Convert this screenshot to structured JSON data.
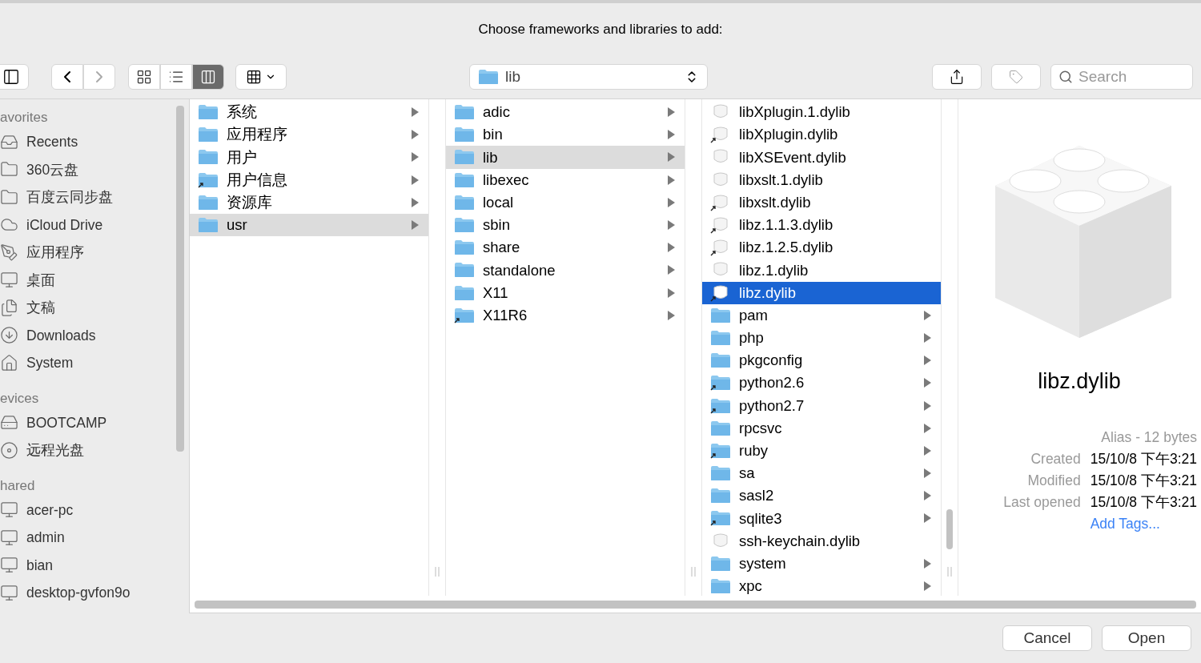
{
  "window": {
    "title": "Choose frameworks and libraries to add:"
  },
  "toolbar": {
    "views": [
      {
        "kind": "icons",
        "selected": false
      },
      {
        "kind": "list",
        "selected": false
      },
      {
        "kind": "columns",
        "selected": true
      }
    ],
    "path": "lib",
    "search": {
      "placeholder": "Search"
    }
  },
  "sidebar": {
    "sections": [
      {
        "heading": "avorites",
        "items": [
          {
            "label": "Recents",
            "kind": "recents"
          },
          {
            "label": "360云盘",
            "kind": "folder"
          },
          {
            "label": "百度云同步盘",
            "kind": "folder"
          },
          {
            "label": "iCloud Drive",
            "kind": "cloud"
          },
          {
            "label": "应用程序",
            "kind": "apps"
          },
          {
            "label": "桌面",
            "kind": "desktop"
          },
          {
            "label": "文稿",
            "kind": "documents"
          },
          {
            "label": "Downloads",
            "kind": "downloads"
          },
          {
            "label": "System",
            "kind": "home"
          }
        ]
      },
      {
        "heading": "evices",
        "items": [
          {
            "label": "BOOTCAMP",
            "kind": "disk"
          },
          {
            "label": "远程光盘",
            "kind": "disc"
          }
        ]
      },
      {
        "heading": "hared",
        "items": [
          {
            "label": "acer-pc",
            "kind": "computer"
          },
          {
            "label": "admin",
            "kind": "computer"
          },
          {
            "label": "bian",
            "kind": "computer"
          },
          {
            "label": "desktop-gvfon9o",
            "kind": "computer"
          }
        ]
      }
    ]
  },
  "columns": [
    {
      "active": false,
      "items": [
        {
          "name": "系统",
          "kind": "folder",
          "alias": false,
          "selected": false
        },
        {
          "name": "应用程序",
          "kind": "folder",
          "alias": false,
          "selected": false
        },
        {
          "name": "用户",
          "kind": "folder",
          "alias": false,
          "selected": false
        },
        {
          "name": "用户信息",
          "kind": "folder",
          "alias": true,
          "selected": false
        },
        {
          "name": "资源库",
          "kind": "folder",
          "alias": false,
          "selected": false
        },
        {
          "name": "usr",
          "kind": "folder",
          "alias": false,
          "selected": true
        }
      ]
    },
    {
      "active": false,
      "items": [
        {
          "name": "adic",
          "kind": "folder",
          "alias": false,
          "selected": false
        },
        {
          "name": "bin",
          "kind": "folder",
          "alias": false,
          "selected": false
        },
        {
          "name": "lib",
          "kind": "folder",
          "alias": false,
          "selected": true
        },
        {
          "name": "libexec",
          "kind": "folder",
          "alias": false,
          "selected": false
        },
        {
          "name": "local",
          "kind": "folder",
          "alias": false,
          "selected": false
        },
        {
          "name": "sbin",
          "kind": "folder",
          "alias": false,
          "selected": false
        },
        {
          "name": "share",
          "kind": "folder",
          "alias": false,
          "selected": false
        },
        {
          "name": "standalone",
          "kind": "folder",
          "alias": false,
          "selected": false
        },
        {
          "name": "X11",
          "kind": "folder",
          "alias": false,
          "selected": false
        },
        {
          "name": "X11R6",
          "kind": "folder",
          "alias": true,
          "selected": false
        }
      ]
    },
    {
      "active": true,
      "items": [
        {
          "name": "libXplugin.1.dylib",
          "kind": "library",
          "alias": false,
          "selected": false
        },
        {
          "name": "libXplugin.dylib",
          "kind": "library",
          "alias": true,
          "selected": false
        },
        {
          "name": "libXSEvent.dylib",
          "kind": "library",
          "alias": false,
          "selected": false
        },
        {
          "name": "libxslt.1.dylib",
          "kind": "library",
          "alias": false,
          "selected": false
        },
        {
          "name": "libxslt.dylib",
          "kind": "library",
          "alias": true,
          "selected": false
        },
        {
          "name": "libz.1.1.3.dylib",
          "kind": "library",
          "alias": true,
          "selected": false
        },
        {
          "name": "libz.1.2.5.dylib",
          "kind": "library",
          "alias": true,
          "selected": false
        },
        {
          "name": "libz.1.dylib",
          "kind": "library",
          "alias": false,
          "selected": false
        },
        {
          "name": "libz.dylib",
          "kind": "library",
          "alias": true,
          "selected": true
        },
        {
          "name": "pam",
          "kind": "folder",
          "alias": false,
          "selected": false
        },
        {
          "name": "php",
          "kind": "folder",
          "alias": false,
          "selected": false
        },
        {
          "name": "pkgconfig",
          "kind": "folder",
          "alias": false,
          "selected": false
        },
        {
          "name": "python2.6",
          "kind": "folder",
          "alias": true,
          "selected": false
        },
        {
          "name": "python2.7",
          "kind": "folder",
          "alias": true,
          "selected": false
        },
        {
          "name": "rpcsvc",
          "kind": "folder",
          "alias": false,
          "selected": false
        },
        {
          "name": "ruby",
          "kind": "folder",
          "alias": true,
          "selected": false
        },
        {
          "name": "sa",
          "kind": "folder",
          "alias": false,
          "selected": false
        },
        {
          "name": "sasl2",
          "kind": "folder",
          "alias": false,
          "selected": false
        },
        {
          "name": "sqlite3",
          "kind": "folder",
          "alias": true,
          "selected": false
        },
        {
          "name": "ssh-keychain.dylib",
          "kind": "library",
          "alias": false,
          "selected": false
        },
        {
          "name": "system",
          "kind": "folder",
          "alias": false,
          "selected": false
        },
        {
          "name": "xpc",
          "kind": "folder",
          "alias": false,
          "selected": false
        }
      ]
    }
  ],
  "preview": {
    "name": "libz.dylib",
    "info": "Alias - 12 bytes",
    "details": [
      {
        "label": "Created",
        "value": "15/10/8 下午3:21"
      },
      {
        "label": "Modified",
        "value": "15/10/8 下午3:21"
      },
      {
        "label": "Last opened",
        "value": "15/10/8 下午3:21"
      }
    ],
    "link": "Add Tags..."
  },
  "buttons": [
    "Cancel",
    "Open"
  ]
}
